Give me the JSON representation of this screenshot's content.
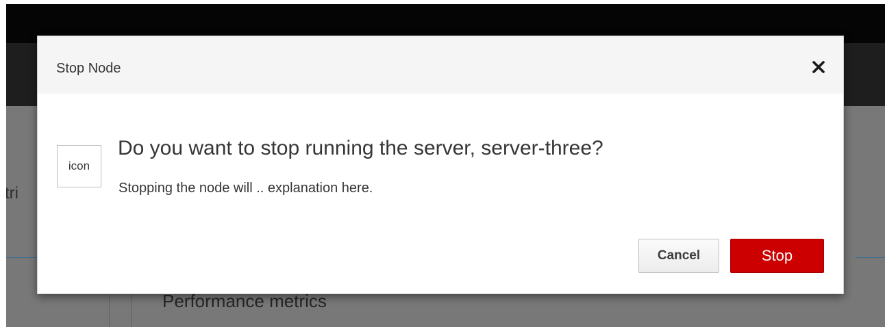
{
  "background": {
    "tab_fragment": "tri",
    "section_heading": "Performance metrics"
  },
  "dialog": {
    "title": "Stop Node",
    "close_icon": "close-icon",
    "icon_placeholder": "icon",
    "question": "Do you want to stop running the server, server-three?",
    "explanation": "Stopping the node will .. explanation here.",
    "buttons": {
      "cancel": "Cancel",
      "stop": "Stop"
    }
  },
  "colors": {
    "danger": "#cc0000",
    "text": "#363636",
    "header_bg": "#f5f5f5"
  }
}
